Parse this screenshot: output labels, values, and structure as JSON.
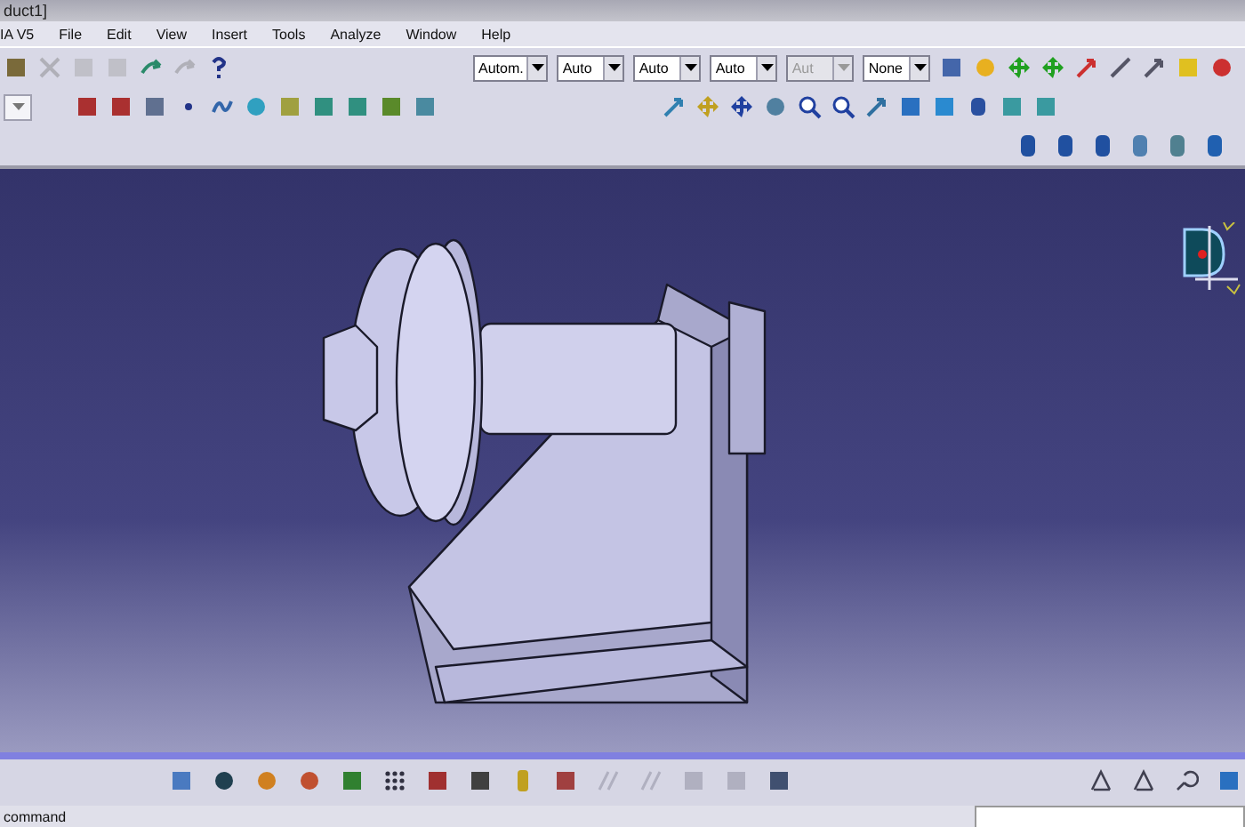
{
  "window": {
    "title": "duct1]"
  },
  "menu": [
    {
      "label": "IA V5"
    },
    {
      "label": "File"
    },
    {
      "label": "Edit"
    },
    {
      "label": "View"
    },
    {
      "label": "Insert"
    },
    {
      "label": "Tools"
    },
    {
      "label": "Analyze"
    },
    {
      "label": "Window"
    },
    {
      "label": "Help"
    }
  ],
  "toolbar": {
    "dropdowns": [
      {
        "value": "Autom.",
        "disabled": false
      },
      {
        "value": "Auto",
        "disabled": false
      },
      {
        "value": "Auto",
        "disabled": false
      },
      {
        "value": "Auto",
        "disabled": false
      },
      {
        "value": "Aut",
        "disabled": true
      },
      {
        "value": "None",
        "disabled": false
      }
    ]
  },
  "status_bar": {
    "message": "command"
  }
}
